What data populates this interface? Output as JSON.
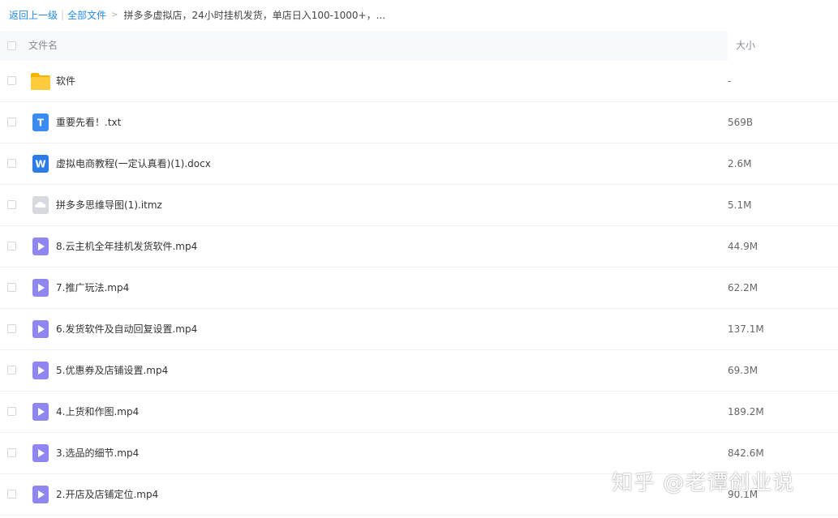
{
  "breadcrumb": {
    "back": "返回上一级",
    "separator": "|",
    "all_files": "全部文件",
    "arrow": ">",
    "current": "拼多多虚拟店，24小时挂机发货，单店日入100-1000+，..."
  },
  "header": {
    "name_label": "文件名",
    "size_label": "大小"
  },
  "files": [
    {
      "icon": "folder-icon",
      "name": "软件",
      "size": "-"
    },
    {
      "icon": "txt-file-icon",
      "glyph": "T",
      "color": "#3b8cf0",
      "name": "重要先看！.txt",
      "size": "569B"
    },
    {
      "icon": "word-file-icon",
      "glyph": "W",
      "color": "#2b7ce9",
      "name": "虚拟电商教程(一定认真看)(1).docx",
      "size": "2.6M"
    },
    {
      "icon": "mindmap-file-icon",
      "color": "#d6d9de",
      "name": "拼多多思维导图(1).itmz",
      "size": "5.1M"
    },
    {
      "icon": "video-file-icon",
      "color": "#8f86ef",
      "name": "8.云主机全年挂机发货软件.mp4",
      "size": "44.9M"
    },
    {
      "icon": "video-file-icon",
      "color": "#8f86ef",
      "name": "7.推广玩法.mp4",
      "size": "62.2M"
    },
    {
      "icon": "video-file-icon",
      "color": "#8f86ef",
      "name": "6.发货软件及自动回复设置.mp4",
      "size": "137.1M"
    },
    {
      "icon": "video-file-icon",
      "color": "#8f86ef",
      "name": "5.优惠券及店铺设置.mp4",
      "size": "69.3M"
    },
    {
      "icon": "video-file-icon",
      "color": "#8f86ef",
      "name": "4.上货和作图.mp4",
      "size": "189.2M"
    },
    {
      "icon": "video-file-icon",
      "color": "#8f86ef",
      "name": "3.选品的细节.mp4",
      "size": "842.6M"
    },
    {
      "icon": "video-file-icon",
      "color": "#8f86ef",
      "name": "2.开店及店铺定位.mp4",
      "size": "90.1M"
    }
  ],
  "watermark": "知乎 @老谭创业说"
}
